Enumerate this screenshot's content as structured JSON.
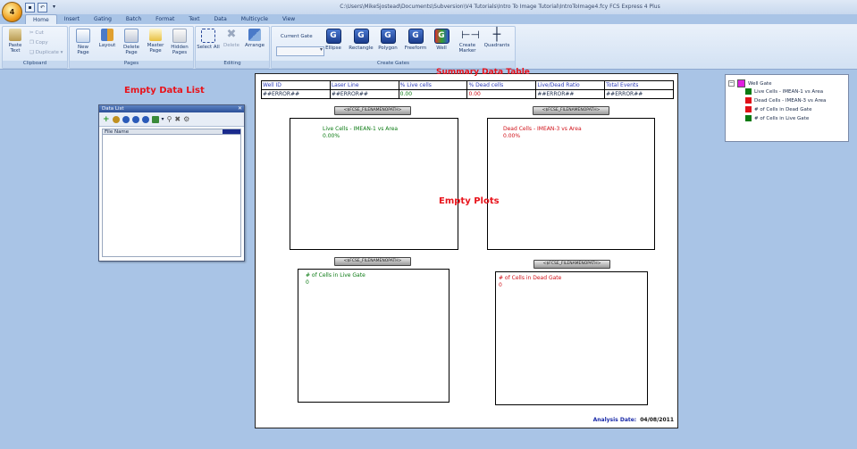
{
  "window": {
    "title": "C:\\Users\\MikeSjostead\\Documents\\Subversion\\V4 Tutorials\\Intro To Image Tutorial\\IntroToImage4.fcy   FCS Express 4 Plus"
  },
  "tabs": [
    "Home",
    "Insert",
    "Gating",
    "Batch",
    "Format",
    "Text",
    "Data",
    "Multicycle",
    "View"
  ],
  "ribbon": {
    "clipboard": {
      "label": "Clipboard",
      "paste": "Paste Text",
      "cut": "Cut",
      "copy": "Copy",
      "duplicate": "Duplicate"
    },
    "pages": {
      "label": "Pages",
      "new_page": "New Page",
      "layout": "Layout",
      "delete_page": "Delete Page",
      "master_page": "Master Page",
      "hidden_pages": "Hidden Pages"
    },
    "editing": {
      "label": "Editing",
      "select_all": "Select All",
      "delete": "Delete",
      "arrange": "Arrange"
    },
    "create_gates": {
      "label": "Create Gates",
      "current_gate": "Current Gate",
      "ellipse": "Ellipse",
      "rectangle": "Rectangle",
      "polygon": "Polygon",
      "freeform": "Freeform",
      "well": "Well",
      "create_marker": "Create Marker",
      "quadrants": "Quadrants"
    }
  },
  "annotations": {
    "empty_data_list": "Empty Data List",
    "summary_table": "Summary Data Table",
    "empty_plots": "Empty Plots"
  },
  "data_list": {
    "title": "Data List",
    "column": "File Name"
  },
  "summary_table": {
    "headers": [
      "Well ID",
      "Laser Line",
      "% Live cells",
      "% Dead cells",
      "Live/Dead Ratio",
      "Total Events"
    ],
    "values": [
      "##ERROR##",
      "##ERROR##",
      "0.00",
      "0.00",
      "##ERROR##",
      "##ERROR##"
    ]
  },
  "plots": {
    "filename_token": "<$FCSE_FILENAMENOPATH>",
    "live_label": "Live Cells - IMEAN-1 vs Area",
    "live_value": "0.00%",
    "dead_label": "Dead Cells - IMEAN-3 vs Area",
    "dead_value": "0.00%",
    "live_count_label": "# of Cells in Live Gate",
    "live_count_value": "0",
    "dead_count_label": "# of Cells in Dead Gate",
    "dead_count_value": "0"
  },
  "analysis": {
    "label": "Analysis Date:",
    "date": "04/08/2011"
  },
  "gate_tree": {
    "root": "Well Gate",
    "items": [
      {
        "label": "Live Cells - IMEAN-1 vs Area",
        "color": "#0a7a12"
      },
      {
        "label": "Dead Cells - IMEAN-3 vs Area",
        "color": "#e01018"
      },
      {
        "label": "# of Cells in Dead Gate",
        "color": "#e01018"
      },
      {
        "label": "# of Cells in Live Gate",
        "color": "#0a7a12"
      }
    ],
    "root_color": "#e020e0"
  },
  "colors": {
    "green_text": "#0a7a12",
    "red_text": "#d01018",
    "accent_blue": "#2a3ab8"
  }
}
